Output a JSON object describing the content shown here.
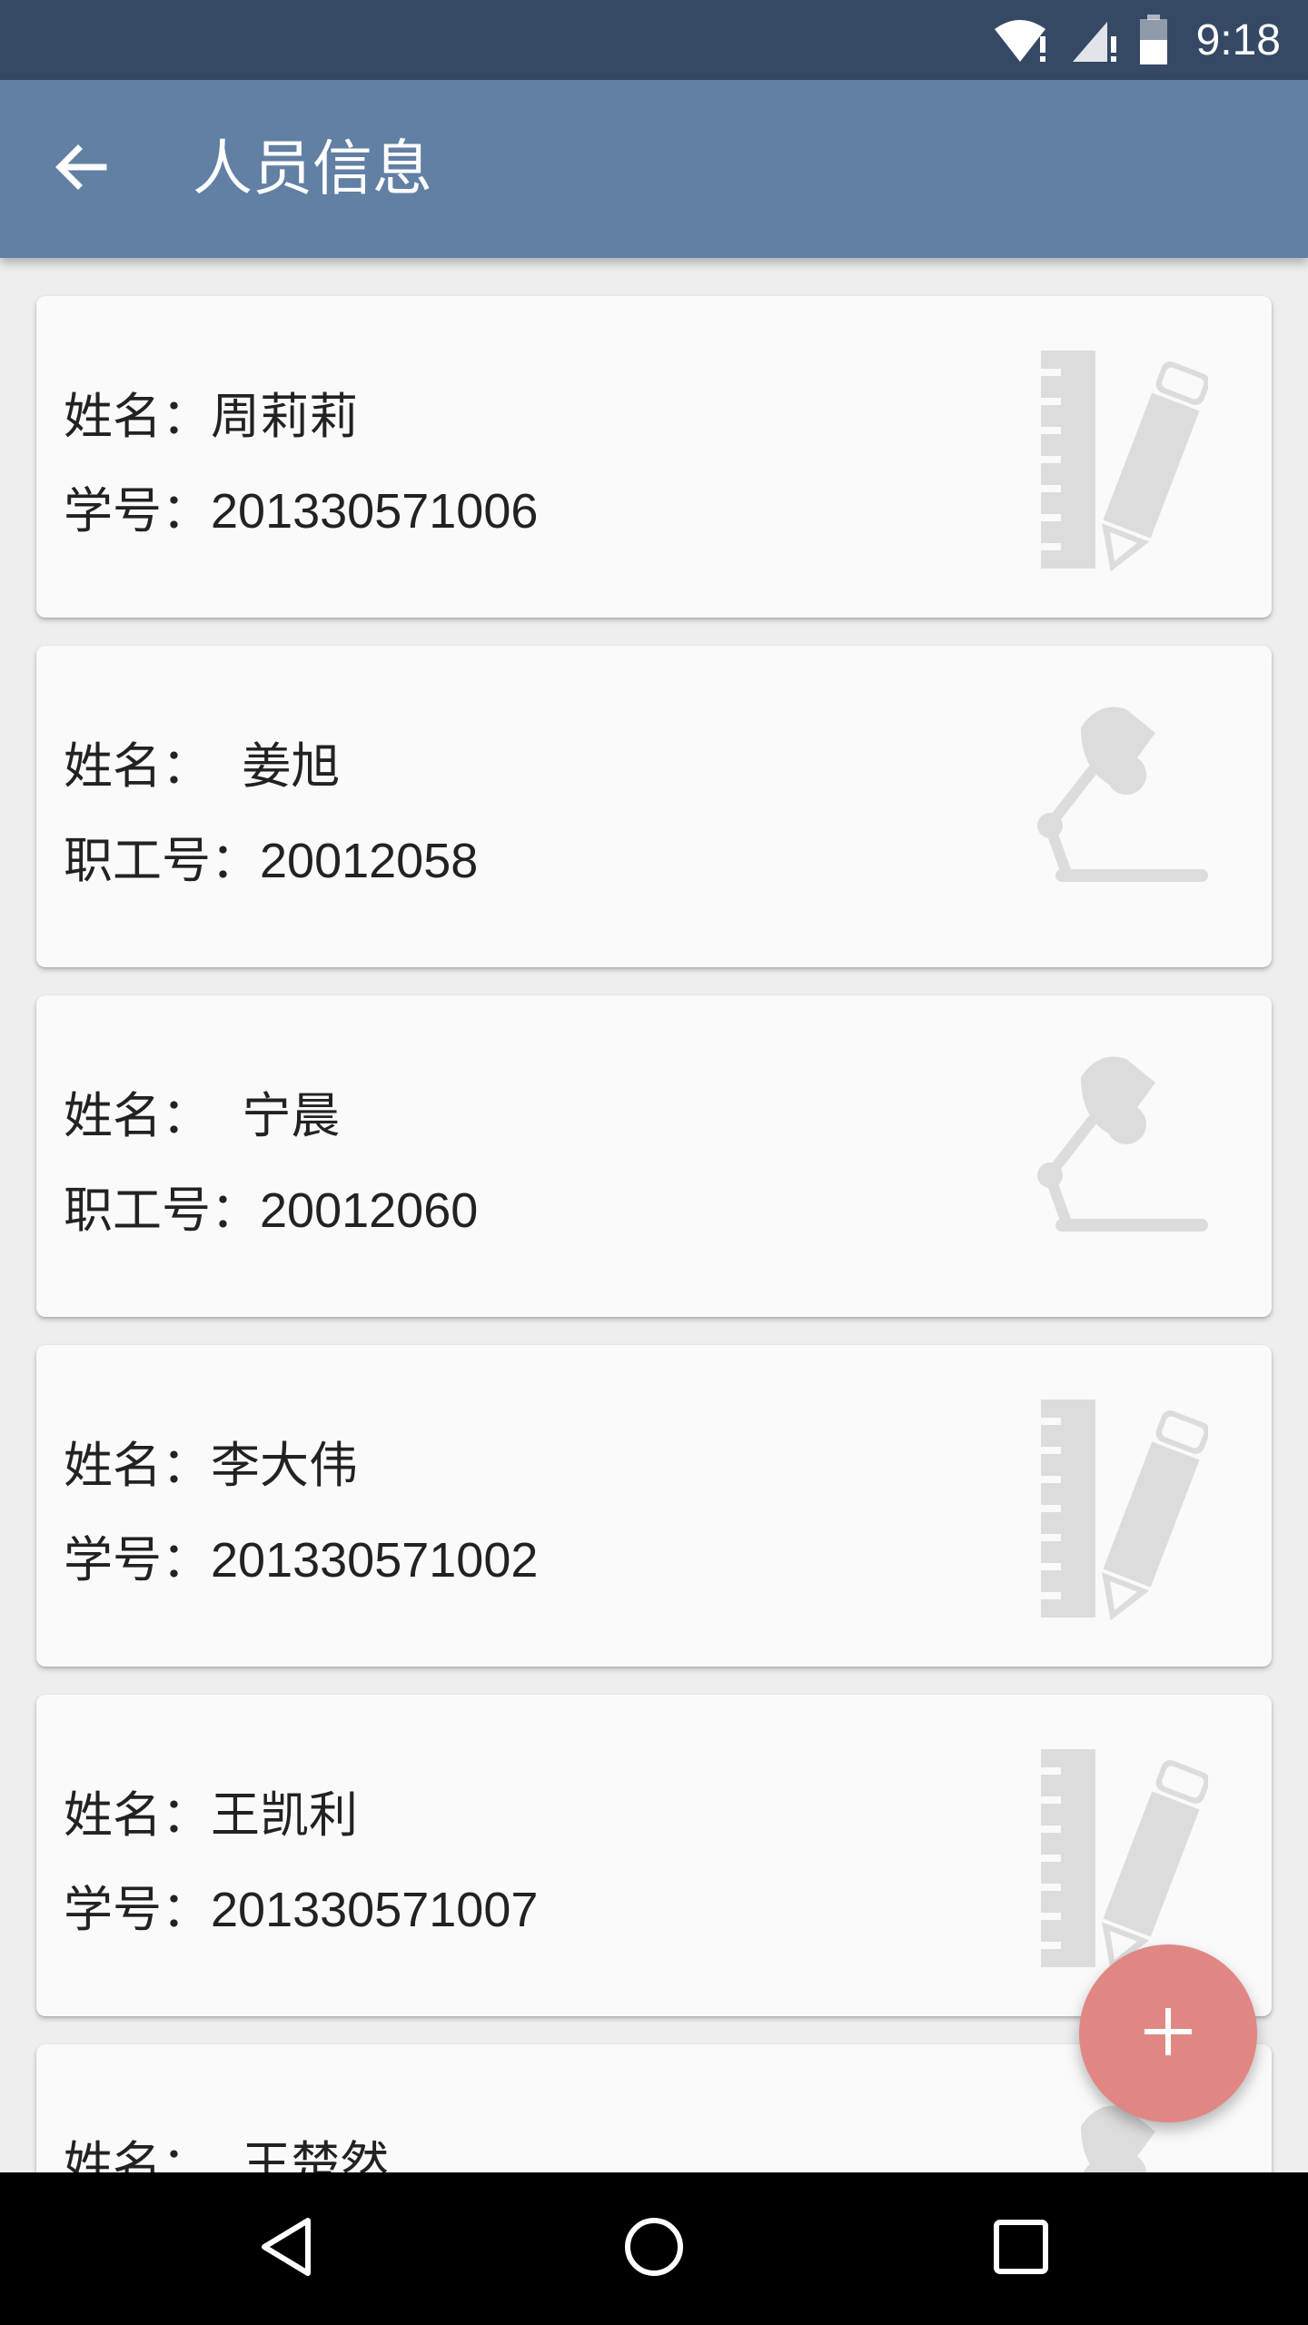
{
  "status_bar": {
    "time": "9:18",
    "icons": [
      "wifi-icon",
      "cell-signal-icon",
      "battery-icon"
    ]
  },
  "app_bar": {
    "title": "人员信息",
    "back_icon": "arrow-back-icon",
    "background": "#627fa4"
  },
  "cards": [
    {
      "line1": {
        "label": "姓名：",
        "value": "周莉莉"
      },
      "line2": {
        "label": "学号：",
        "value": "201330571006"
      },
      "icon": "ruler-pencil-icon"
    },
    {
      "line1": {
        "label": "姓名：  ",
        "value": "姜旭"
      },
      "line2": {
        "label": "职工号：",
        "value": "20012058"
      },
      "icon": "desk-lamp-icon"
    },
    {
      "line1": {
        "label": "姓名：  ",
        "value": "宁晨"
      },
      "line2": {
        "label": "职工号：",
        "value": "20012060"
      },
      "icon": "desk-lamp-icon"
    },
    {
      "line1": {
        "label": "姓名：",
        "value": "李大伟"
      },
      "line2": {
        "label": "学号：",
        "value": "201330571002"
      },
      "icon": "ruler-pencil-icon"
    },
    {
      "line1": {
        "label": "姓名：",
        "value": "王凯利"
      },
      "line2": {
        "label": "学号：",
        "value": "201330571007"
      },
      "icon": "ruler-pencil-icon"
    },
    {
      "line1": {
        "label": "姓名：  ",
        "value": "王楚然"
      },
      "line2": {
        "label": "",
        "value": ""
      },
      "icon": "desk-lamp-icon"
    }
  ],
  "fab": {
    "icon": "plus-icon",
    "color": "#e08784"
  },
  "nav_bar": {
    "buttons": [
      "back-triangle-icon",
      "home-circle-icon",
      "recents-square-icon"
    ]
  }
}
